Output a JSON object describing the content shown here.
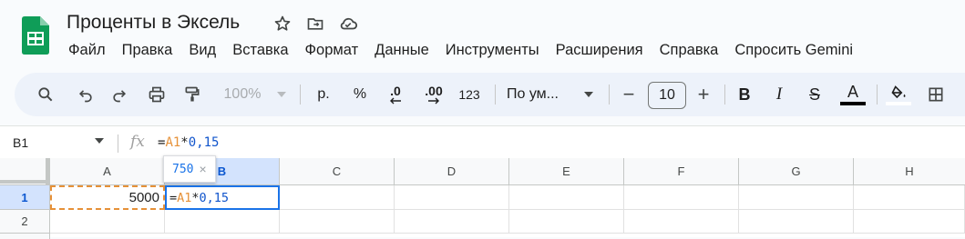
{
  "document": {
    "title": "Проценты в Эксель",
    "star_icon": "star-icon",
    "move_icon": "folder-move-icon",
    "cloud_icon": "cloud-saved-icon"
  },
  "menu": [
    "Файл",
    "Правка",
    "Вид",
    "Вставка",
    "Формат",
    "Данные",
    "Инструменты",
    "Расширения",
    "Справка",
    "Спросить Gemini"
  ],
  "toolbar": {
    "zoom": "100%",
    "currency": "р.",
    "percent": "%",
    "decrease_decimals": ".0",
    "increase_decimals": ".00",
    "number_format": "123",
    "font": "По ум...",
    "font_size": "10",
    "minus": "−",
    "plus": "+",
    "bold": "B",
    "italic": "I",
    "strikethrough": "S",
    "text_color_label": "A"
  },
  "formula_bar": {
    "name_box": "B1",
    "fx": "fx",
    "formula_eq": "=",
    "formula_ref": "A1",
    "formula_op": "*",
    "formula_num": "0,15"
  },
  "grid": {
    "columns": [
      "A",
      "B",
      "C",
      "D",
      "E",
      "F",
      "G",
      "H"
    ],
    "rows": [
      "1",
      "2"
    ],
    "a1": "5000",
    "b1_eq": "=",
    "b1_ref": "A1",
    "b1_op": "*",
    "b1_num": "0,15",
    "preview_value": "750",
    "preview_close": "×"
  },
  "colors": {
    "accent": "#0b57d0",
    "reference": "#e69138",
    "number": "#1155cc",
    "selected_header": "#d3e3fd"
  }
}
